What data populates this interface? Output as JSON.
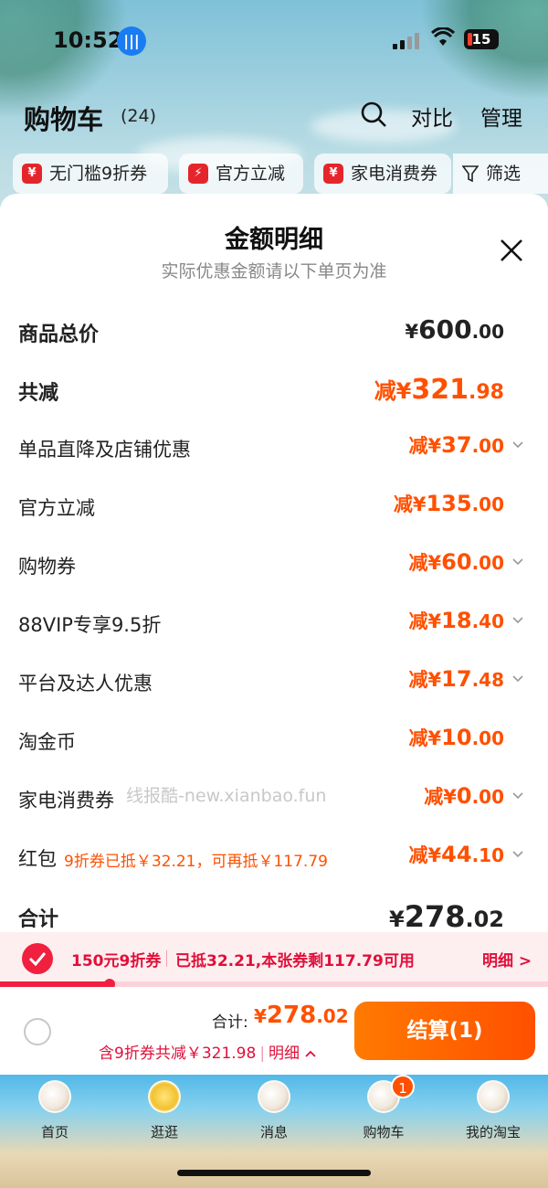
{
  "status_bar": {
    "time": "10:52",
    "battery": "15"
  },
  "header": {
    "title": "购物车",
    "count": "(24)",
    "compare": "对比",
    "manage": "管理"
  },
  "chips": [
    {
      "label": "无门槛9折券",
      "icon": "coupon-icon"
    },
    {
      "label": "官方立减",
      "icon": "lightning-icon"
    },
    {
      "label": "家电消费券",
      "icon": "coupon-icon"
    }
  ],
  "filter_label": "筛选",
  "sheet": {
    "title": "金额明细",
    "subtitle": "实际优惠金额请以下单页为准",
    "rows": [
      {
        "label": "商品总价",
        "prefix": "¥",
        "int": "600",
        "dec": ".00"
      },
      {
        "label": "共减",
        "prefix": "减¥",
        "int": "321",
        "dec": ".98"
      },
      {
        "label": "单品直降及店铺优惠",
        "prefix": "减¥",
        "int": "37",
        "dec": ".00"
      },
      {
        "label": "官方立减",
        "prefix": "减¥",
        "int": "135",
        "dec": ".00"
      },
      {
        "label": "购物券",
        "prefix": "减¥",
        "int": "60",
        "dec": ".00"
      },
      {
        "label": "88VIP专享9.5折",
        "prefix": "减¥",
        "int": "18",
        "dec": ".40"
      },
      {
        "label": "平台及达人优惠",
        "prefix": "减¥",
        "int": "17",
        "dec": ".48"
      },
      {
        "label": "淘金币",
        "prefix": "减¥",
        "int": "10",
        "dec": ".00"
      },
      {
        "label": "家电消费券",
        "prefix": "减¥",
        "int": "0",
        "dec": ".00",
        "watermark": "线报酷-new.xianbao.fun"
      },
      {
        "label": "红包",
        "note": "9折券已抵￥32.21，可再抵￥117.79",
        "prefix": "减¥",
        "int": "44",
        "dec": ".10"
      },
      {
        "label": "合计",
        "prefix": "¥",
        "int": "278",
        "dec": ".02"
      }
    ]
  },
  "coupon_strip": {
    "name": "150元9折券",
    "desc": "已抵32.21,本张券剩117.79可用",
    "detail": "明细 >",
    "progress": 0.2
  },
  "checkout": {
    "sum_label": "合计:",
    "prefix": "¥",
    "int": "278",
    "dec": ".02",
    "save_text": "含9折券共减￥321.98",
    "detail_text": "明细",
    "pay_label": "结算(1)"
  },
  "tabbar": {
    "items": [
      "首页",
      "逛逛",
      "消息",
      "购物车",
      "我的淘宝"
    ],
    "cart_badge": "1"
  },
  "colors": {
    "accent": "#ff5000",
    "red": "#e0103a"
  }
}
